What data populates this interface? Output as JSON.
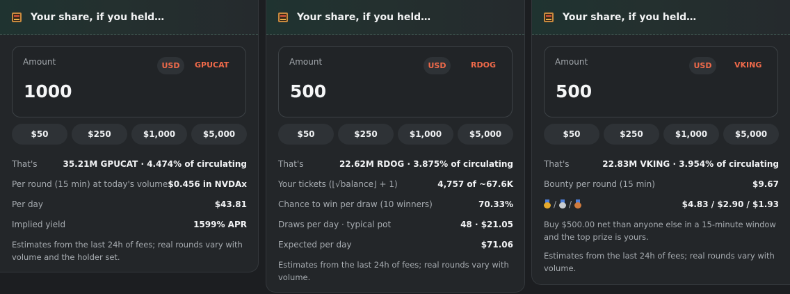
{
  "cards": [
    {
      "header_title": "Your share, if you held…",
      "amount_label": "Amount",
      "amount_value": "1000",
      "currency_usd": "USD",
      "currency_token": "GPUCAT",
      "presets": [
        "$50",
        "$250",
        "$1,000",
        "$5,000"
      ],
      "rows": [
        {
          "label": "That's",
          "value": "35.21M GPUCAT · 4.474% of circulating"
        },
        {
          "label": "Per round (15 min) at today's volume",
          "value": "$0.456 in NVDAx"
        },
        {
          "label": "Per day",
          "value": "$43.81"
        },
        {
          "label": "Implied yield",
          "value": "1599% APR"
        }
      ],
      "note": "Estimates from the last 24h of fees; real rounds vary with volume and the holder set."
    },
    {
      "header_title": "Your share, if you held…",
      "amount_label": "Amount",
      "amount_value": "500",
      "currency_usd": "USD",
      "currency_token": "RDOG",
      "presets": [
        "$50",
        "$250",
        "$1,000",
        "$5,000"
      ],
      "rows": [
        {
          "label": "That's",
          "value": "22.62M RDOG · 3.875% of circulating"
        },
        {
          "label": "Your tickets (⌊√balance⌋ + 1)",
          "value": "4,757 of ~67.6K"
        },
        {
          "label": "Chance to win per draw (10 winners)",
          "value": "70.33%"
        },
        {
          "label": "Draws per day · typical pot",
          "value": "48 · $21.05"
        },
        {
          "label": "Expected per day",
          "value": "$71.06"
        }
      ],
      "note": "Estimates from the last 24h of fees; real rounds vary with volume."
    },
    {
      "header_title": "Your share, if you held…",
      "amount_label": "Amount",
      "amount_value": "500",
      "currency_usd": "USD",
      "currency_token": "VKING",
      "presets": [
        "$50",
        "$250",
        "$1,000",
        "$5,000"
      ],
      "rows": [
        {
          "label": "That's",
          "value": "22.83M VKING · 3.954% of circulating"
        },
        {
          "label": "Bounty per round (15 min)",
          "value": "$9.67"
        },
        {
          "label": "/ /",
          "value": "$4.83 / $2.90 / $1.93"
        }
      ],
      "note_prize": "Buy $500.00 net than anyone else in a 15-minute window and the top prize is yours.",
      "note": "Estimates from the last 24h of fees; real rounds vary with volume."
    }
  ],
  "icons": {
    "header": "abacus-icon",
    "medals": [
      "gold-medal-icon",
      "silver-medal-icon",
      "bronze-medal-icon"
    ]
  },
  "colors": {
    "accent": "#f06a4a",
    "background": "#1c1e21",
    "card": "#232629"
  }
}
